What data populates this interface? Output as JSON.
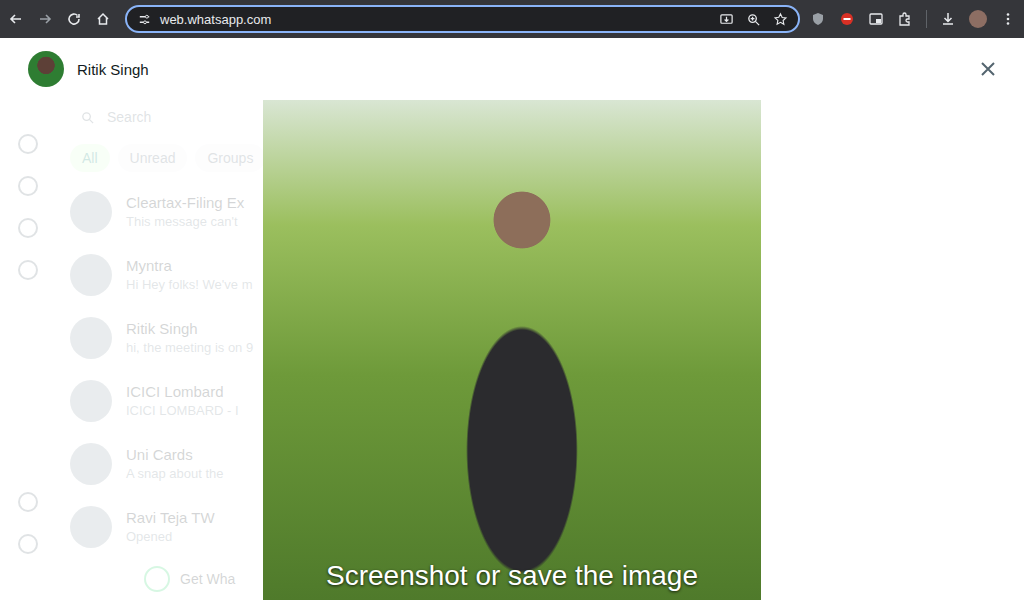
{
  "browser": {
    "url": "web.whatsapp.com"
  },
  "viewer": {
    "contact_name": "Ritik Singh",
    "caption": "Screenshot or save the image"
  },
  "background": {
    "search_placeholder": "Search",
    "filters": [
      {
        "label": "All",
        "selected": true
      },
      {
        "label": "Unread",
        "selected": false
      },
      {
        "label": "Groups",
        "selected": false
      }
    ],
    "chats": [
      {
        "name": "Cleartax-Filing Ex",
        "preview": "This message can't"
      },
      {
        "name": "Myntra",
        "preview": "Hi Hey folks! We've m"
      },
      {
        "name": "Ritik Singh",
        "preview": "hi, the meeting is on 9"
      },
      {
        "name": "ICICI Lombard",
        "preview": "ICICI LOMBARD - I"
      },
      {
        "name": "Uni Cards",
        "preview": "A snap about the"
      },
      {
        "name": "Ravi Teja TW",
        "preview": "Opened"
      }
    ],
    "banner": "Get Wha"
  }
}
